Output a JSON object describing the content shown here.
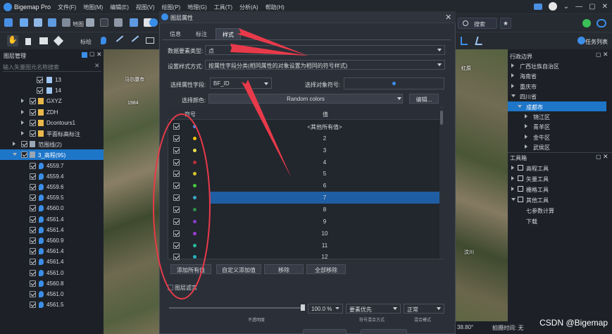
{
  "app": {
    "title": "Bigemap Pro",
    "menu": [
      "文件(F)",
      "地图(M)",
      "编辑(E)",
      "视图(V)",
      "绘图(P)",
      "地理(G)",
      "工具(T)",
      "分析(A)",
      "帮助(H)"
    ]
  },
  "toolbar": {
    "map_label": "地图",
    "mark_label": "标绘",
    "search_label": "搜索",
    "task_label": "任务列表"
  },
  "left_panel": {
    "title": "图层管理",
    "search_placeholder": "输入矢量图元名称搜索",
    "rows": [
      {
        "label": "13",
        "kind": "line"
      },
      {
        "label": "14",
        "kind": "line"
      },
      {
        "label": "GXYZ",
        "kind": "folder"
      },
      {
        "label": "ZDH",
        "kind": "folder"
      },
      {
        "label": "Dcontours1",
        "kind": "folder"
      },
      {
        "label": "平面标高标注",
        "kind": "folder"
      },
      {
        "label": "范围线(2)",
        "kind": "stack"
      },
      {
        "label": "3_高程(95)",
        "kind": "stack",
        "selected": true
      },
      {
        "label": "4559.7",
        "kind": "point"
      },
      {
        "label": "4559.4",
        "kind": "point"
      },
      {
        "label": "4559.6",
        "kind": "point"
      },
      {
        "label": "4559.5",
        "kind": "point"
      },
      {
        "label": "4560.0",
        "kind": "point"
      },
      {
        "label": "4561.4",
        "kind": "point"
      },
      {
        "label": "4561.4",
        "kind": "point"
      },
      {
        "label": "4560.9",
        "kind": "point"
      },
      {
        "label": "4561.4",
        "kind": "point"
      },
      {
        "label": "4561.4",
        "kind": "point"
      },
      {
        "label": "4561.0",
        "kind": "point"
      },
      {
        "label": "4560.8",
        "kind": "point"
      },
      {
        "label": "4561.0",
        "kind": "point"
      },
      {
        "label": "4561.5",
        "kind": "point"
      }
    ]
  },
  "map_labels": {
    "left_1": "马尔康市",
    "left_2": "1984",
    "right_1": "红原",
    "right_2": "汶川"
  },
  "dialog": {
    "title": "图层属性",
    "tabs": [
      "信息",
      "标注",
      "样式"
    ],
    "active_tab": "样式",
    "feature_type_label": "数据要素类型:",
    "feature_type_value": "点",
    "style_mode_label": "设置样式方式:",
    "style_mode_value": "按属性字段分类(相同属性的对象设置为相同的符号样式)",
    "attr_field_label": "选择属性字段:",
    "attr_field_value": "BF_ID",
    "symbol_label": "选择对象符号:",
    "color_label": "选择颜色:",
    "color_value": "Random colors",
    "edit_label": "编辑...",
    "col_symbol": "符号",
    "col_value": "值",
    "rows": [
      {
        "value": "<其他所有值>",
        "color": "#3b8ee8"
      },
      {
        "value": "2",
        "color": "#f2c500"
      },
      {
        "value": "3",
        "color": "#e8e04a"
      },
      {
        "value": "4",
        "color": "#b8323a"
      },
      {
        "value": "5",
        "color": "#d9c72a"
      },
      {
        "value": "6",
        "color": "#46c83c"
      },
      {
        "value": "7",
        "color": "#3aa7c8",
        "selected": true
      },
      {
        "value": "8",
        "color": "#2c8f4a"
      },
      {
        "value": "9",
        "color": "#8a3bc8"
      },
      {
        "value": "10",
        "color": "#9a3dd0"
      },
      {
        "value": "11",
        "color": "#28b89a"
      },
      {
        "value": "12",
        "color": "#26b5c2"
      }
    ],
    "buttons": [
      "添加所有值",
      "自定义添加值",
      "移除",
      "全部移除"
    ],
    "layer_fill_label": "图层滤实",
    "opacity_value": "100.0 %",
    "priority_value": "要素优先",
    "blend_value": "正常",
    "opacity_caption": "不透明度",
    "symbol_blend_caption": "符号混合方式",
    "blend_caption": "混合模式"
  },
  "right_panel": {
    "admin_title": "行政边界",
    "items": [
      {
        "label": "广西壮族自治区",
        "depth": 1,
        "exp": "r"
      },
      {
        "label": "海南省",
        "depth": 1,
        "exp": "r"
      },
      {
        "label": "重庆市",
        "depth": 1,
        "exp": "r"
      },
      {
        "label": "四川省",
        "depth": 1,
        "exp": "d"
      },
      {
        "label": "成都市",
        "depth": 2,
        "exp": "d",
        "selected": true
      },
      {
        "label": "锦江区",
        "depth": 3,
        "exp": "r"
      },
      {
        "label": "青羊区",
        "depth": 3,
        "exp": "r"
      },
      {
        "label": "金牛区",
        "depth": 3,
        "exp": "r"
      },
      {
        "label": "武侯区",
        "depth": 3,
        "exp": "r"
      }
    ],
    "toolbox_title": "工具箱",
    "tools": [
      {
        "label": "高程工具",
        "exp": "r"
      },
      {
        "label": "矢量工具",
        "exp": "r"
      },
      {
        "label": "栅格工具",
        "exp": "r"
      },
      {
        "label": "其他工具",
        "exp": "d"
      },
      {
        "label": "七参数计算",
        "exp": ""
      },
      {
        "label": "下载",
        "exp": ""
      }
    ]
  },
  "status": {
    "coord": "38.80°",
    "photo": "拍摄时间: 无"
  },
  "watermark": "CSDN @Bigemap",
  "colors": {
    "accent": "#1e76c9",
    "annotation": "#e83a4a"
  }
}
